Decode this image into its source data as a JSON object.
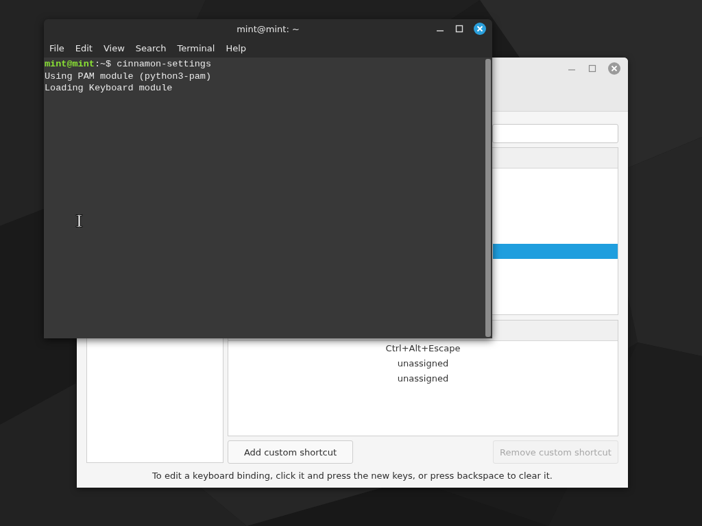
{
  "settings_window": {
    "category_list": {
      "rows": [
        {
          "selected": false
        },
        {
          "selected": false
        },
        {
          "selected": false
        },
        {
          "selected": false
        },
        {
          "selected": false
        },
        {
          "selected": true
        },
        {
          "selected": false
        },
        {
          "selected": false
        },
        {
          "selected": false
        }
      ]
    },
    "bindings": [
      {
        "binding": "Ctrl+Alt+Escape"
      },
      {
        "binding": "unassigned"
      },
      {
        "binding": "unassigned"
      }
    ],
    "buttons": [
      {
        "label": "Add custom shortcut",
        "disabled": false
      },
      {
        "label": "Remove custom shortcut",
        "disabled": true
      }
    ],
    "hint": "To edit a keyboard binding, click it and press the new keys, or press backspace to clear it."
  },
  "terminal": {
    "title": "mint@mint: ~",
    "menu": [
      "File",
      "Edit",
      "View",
      "Search",
      "Terminal",
      "Help"
    ],
    "lines": [
      {
        "kind": "prompt",
        "user": "mint@mint",
        "text": ":~$ cinnamon-settings"
      },
      {
        "kind": "output",
        "text": "Using PAM module (python3-pam)"
      },
      {
        "kind": "output",
        "text": "Loading Keyboard module"
      }
    ]
  }
}
